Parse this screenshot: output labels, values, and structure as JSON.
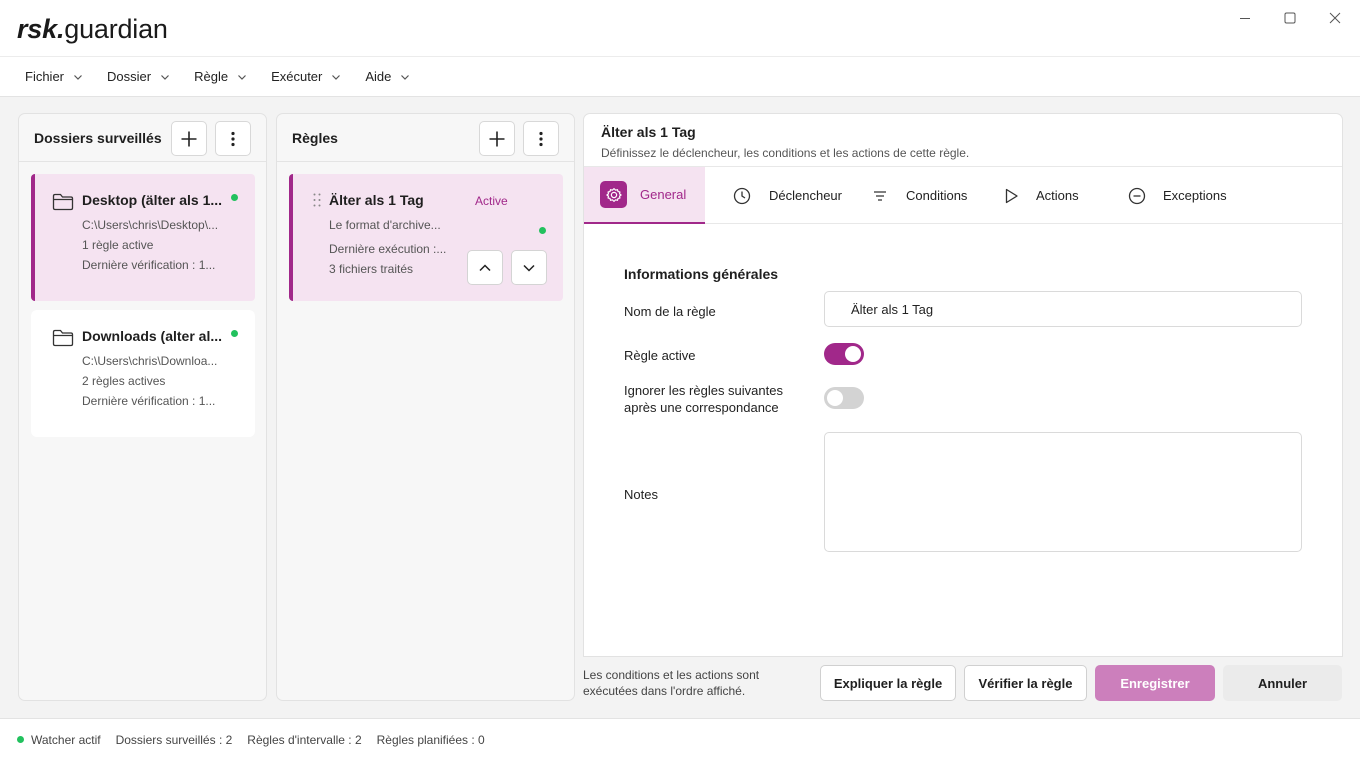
{
  "app": {
    "logo_bold": "rsk.",
    "logo_rest": "guardian"
  },
  "menu": [
    {
      "label": "Fichier"
    },
    {
      "label": "Dossier"
    },
    {
      "label": "Règle"
    },
    {
      "label": "Exécuter"
    },
    {
      "label": "Aide"
    }
  ],
  "folders_panel": {
    "title": "Dossiers surveillés",
    "items": [
      {
        "name": "Desktop (älter als 1...",
        "path": "C:\\Users\\chris\\Desktop\\...",
        "rules": "1 règle active",
        "last_check": "Dernière vérification : 1...",
        "selected": true,
        "status": "active"
      },
      {
        "name": "Downloads (alter al...",
        "path": "C:\\Users\\chris\\Downloa...",
        "rules": "2 règles actives",
        "last_check": "Dernière vérification : 1...",
        "selected": false,
        "status": "active"
      }
    ]
  },
  "rules_panel": {
    "title": "Règles",
    "items": [
      {
        "name": "Älter als 1 Tag",
        "badge": "Active",
        "description": "Le format d'archive...",
        "last_run": "Dernière exécution :...",
        "processed": "3 fichiers traités"
      }
    ]
  },
  "editor": {
    "title": "Älter als 1 Tag",
    "subtitle": "Définissez le déclencheur, les conditions et les actions de cette règle.",
    "tabs": [
      {
        "label": "General",
        "icon": "gear-icon",
        "active": true
      },
      {
        "label": "Déclencheur",
        "icon": "clock-icon",
        "active": false
      },
      {
        "label": "Conditions",
        "icon": "filter-icon",
        "active": false
      },
      {
        "label": "Actions",
        "icon": "play-icon",
        "active": false
      },
      {
        "label": "Exceptions",
        "icon": "minus-circle-icon",
        "active": false
      }
    ],
    "section_title": "Informations générales",
    "rule_name_label": "Nom de la règle",
    "rule_name_value": "Älter als 1 Tag",
    "active_label": "Règle active",
    "active_value": true,
    "ignore_label_1": "Ignorer les règles suivantes",
    "ignore_label_2": "après une correspondance",
    "ignore_value": false,
    "notes_label": "Notes",
    "notes_value": ""
  },
  "footer": {
    "note_line1": "Les conditions et les actions sont",
    "note_line2": "exécutées dans l'ordre affiché.",
    "explain_label": "Expliquer la règle",
    "verify_label": "Vérifier la règle",
    "save_label": "Enregistrer",
    "cancel_label": "Annuler"
  },
  "status": {
    "watcher": "Watcher actif",
    "folders": "Dossiers surveillés : 2",
    "interval_rules": "Règles d'intervalle : 2",
    "scheduled_rules": "Règles planifiées : 0"
  },
  "colors": {
    "accent": "#a1288a",
    "accent_light": "#f5e3f1",
    "save_button": "#cc7fbc",
    "status_green": "#22c15e"
  }
}
